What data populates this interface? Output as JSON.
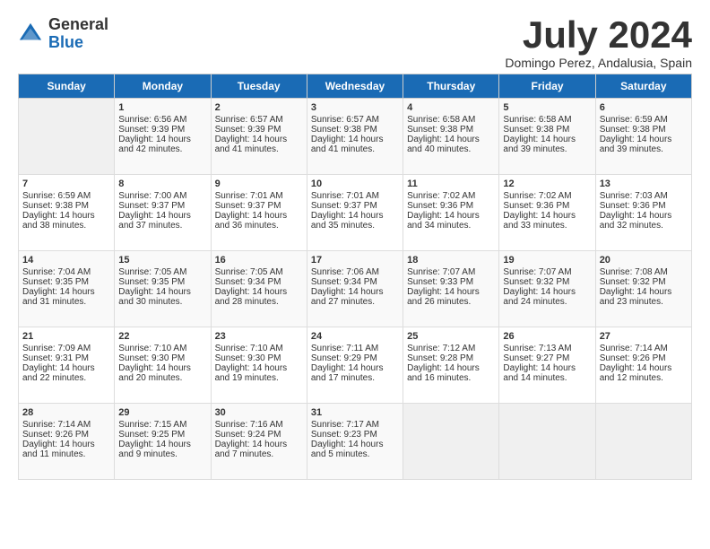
{
  "logo": {
    "general": "General",
    "blue": "Blue"
  },
  "header": {
    "month": "July 2024",
    "location": "Domingo Perez, Andalusia, Spain"
  },
  "days_of_week": [
    "Sunday",
    "Monday",
    "Tuesday",
    "Wednesday",
    "Thursday",
    "Friday",
    "Saturday"
  ],
  "weeks": [
    [
      {
        "day": "",
        "sunrise": "",
        "sunset": "",
        "daylight": ""
      },
      {
        "day": "1",
        "sunrise": "Sunrise: 6:56 AM",
        "sunset": "Sunset: 9:39 PM",
        "daylight": "Daylight: 14 hours and 42 minutes."
      },
      {
        "day": "2",
        "sunrise": "Sunrise: 6:57 AM",
        "sunset": "Sunset: 9:39 PM",
        "daylight": "Daylight: 14 hours and 41 minutes."
      },
      {
        "day": "3",
        "sunrise": "Sunrise: 6:57 AM",
        "sunset": "Sunset: 9:38 PM",
        "daylight": "Daylight: 14 hours and 41 minutes."
      },
      {
        "day": "4",
        "sunrise": "Sunrise: 6:58 AM",
        "sunset": "Sunset: 9:38 PM",
        "daylight": "Daylight: 14 hours and 40 minutes."
      },
      {
        "day": "5",
        "sunrise": "Sunrise: 6:58 AM",
        "sunset": "Sunset: 9:38 PM",
        "daylight": "Daylight: 14 hours and 39 minutes."
      },
      {
        "day": "6",
        "sunrise": "Sunrise: 6:59 AM",
        "sunset": "Sunset: 9:38 PM",
        "daylight": "Daylight: 14 hours and 39 minutes."
      }
    ],
    [
      {
        "day": "7",
        "sunrise": "Sunrise: 6:59 AM",
        "sunset": "Sunset: 9:38 PM",
        "daylight": "Daylight: 14 hours and 38 minutes."
      },
      {
        "day": "8",
        "sunrise": "Sunrise: 7:00 AM",
        "sunset": "Sunset: 9:37 PM",
        "daylight": "Daylight: 14 hours and 37 minutes."
      },
      {
        "day": "9",
        "sunrise": "Sunrise: 7:01 AM",
        "sunset": "Sunset: 9:37 PM",
        "daylight": "Daylight: 14 hours and 36 minutes."
      },
      {
        "day": "10",
        "sunrise": "Sunrise: 7:01 AM",
        "sunset": "Sunset: 9:37 PM",
        "daylight": "Daylight: 14 hours and 35 minutes."
      },
      {
        "day": "11",
        "sunrise": "Sunrise: 7:02 AM",
        "sunset": "Sunset: 9:36 PM",
        "daylight": "Daylight: 14 hours and 34 minutes."
      },
      {
        "day": "12",
        "sunrise": "Sunrise: 7:02 AM",
        "sunset": "Sunset: 9:36 PM",
        "daylight": "Daylight: 14 hours and 33 minutes."
      },
      {
        "day": "13",
        "sunrise": "Sunrise: 7:03 AM",
        "sunset": "Sunset: 9:36 PM",
        "daylight": "Daylight: 14 hours and 32 minutes."
      }
    ],
    [
      {
        "day": "14",
        "sunrise": "Sunrise: 7:04 AM",
        "sunset": "Sunset: 9:35 PM",
        "daylight": "Daylight: 14 hours and 31 minutes."
      },
      {
        "day": "15",
        "sunrise": "Sunrise: 7:05 AM",
        "sunset": "Sunset: 9:35 PM",
        "daylight": "Daylight: 14 hours and 30 minutes."
      },
      {
        "day": "16",
        "sunrise": "Sunrise: 7:05 AM",
        "sunset": "Sunset: 9:34 PM",
        "daylight": "Daylight: 14 hours and 28 minutes."
      },
      {
        "day": "17",
        "sunrise": "Sunrise: 7:06 AM",
        "sunset": "Sunset: 9:34 PM",
        "daylight": "Daylight: 14 hours and 27 minutes."
      },
      {
        "day": "18",
        "sunrise": "Sunrise: 7:07 AM",
        "sunset": "Sunset: 9:33 PM",
        "daylight": "Daylight: 14 hours and 26 minutes."
      },
      {
        "day": "19",
        "sunrise": "Sunrise: 7:07 AM",
        "sunset": "Sunset: 9:32 PM",
        "daylight": "Daylight: 14 hours and 24 minutes."
      },
      {
        "day": "20",
        "sunrise": "Sunrise: 7:08 AM",
        "sunset": "Sunset: 9:32 PM",
        "daylight": "Daylight: 14 hours and 23 minutes."
      }
    ],
    [
      {
        "day": "21",
        "sunrise": "Sunrise: 7:09 AM",
        "sunset": "Sunset: 9:31 PM",
        "daylight": "Daylight: 14 hours and 22 minutes."
      },
      {
        "day": "22",
        "sunrise": "Sunrise: 7:10 AM",
        "sunset": "Sunset: 9:30 PM",
        "daylight": "Daylight: 14 hours and 20 minutes."
      },
      {
        "day": "23",
        "sunrise": "Sunrise: 7:10 AM",
        "sunset": "Sunset: 9:30 PM",
        "daylight": "Daylight: 14 hours and 19 minutes."
      },
      {
        "day": "24",
        "sunrise": "Sunrise: 7:11 AM",
        "sunset": "Sunset: 9:29 PM",
        "daylight": "Daylight: 14 hours and 17 minutes."
      },
      {
        "day": "25",
        "sunrise": "Sunrise: 7:12 AM",
        "sunset": "Sunset: 9:28 PM",
        "daylight": "Daylight: 14 hours and 16 minutes."
      },
      {
        "day": "26",
        "sunrise": "Sunrise: 7:13 AM",
        "sunset": "Sunset: 9:27 PM",
        "daylight": "Daylight: 14 hours and 14 minutes."
      },
      {
        "day": "27",
        "sunrise": "Sunrise: 7:14 AM",
        "sunset": "Sunset: 9:26 PM",
        "daylight": "Daylight: 14 hours and 12 minutes."
      }
    ],
    [
      {
        "day": "28",
        "sunrise": "Sunrise: 7:14 AM",
        "sunset": "Sunset: 9:26 PM",
        "daylight": "Daylight: 14 hours and 11 minutes."
      },
      {
        "day": "29",
        "sunrise": "Sunrise: 7:15 AM",
        "sunset": "Sunset: 9:25 PM",
        "daylight": "Daylight: 14 hours and 9 minutes."
      },
      {
        "day": "30",
        "sunrise": "Sunrise: 7:16 AM",
        "sunset": "Sunset: 9:24 PM",
        "daylight": "Daylight: 14 hours and 7 minutes."
      },
      {
        "day": "31",
        "sunrise": "Sunrise: 7:17 AM",
        "sunset": "Sunset: 9:23 PM",
        "daylight": "Daylight: 14 hours and 5 minutes."
      },
      {
        "day": "",
        "sunrise": "",
        "sunset": "",
        "daylight": ""
      },
      {
        "day": "",
        "sunrise": "",
        "sunset": "",
        "daylight": ""
      },
      {
        "day": "",
        "sunrise": "",
        "sunset": "",
        "daylight": ""
      }
    ]
  ]
}
